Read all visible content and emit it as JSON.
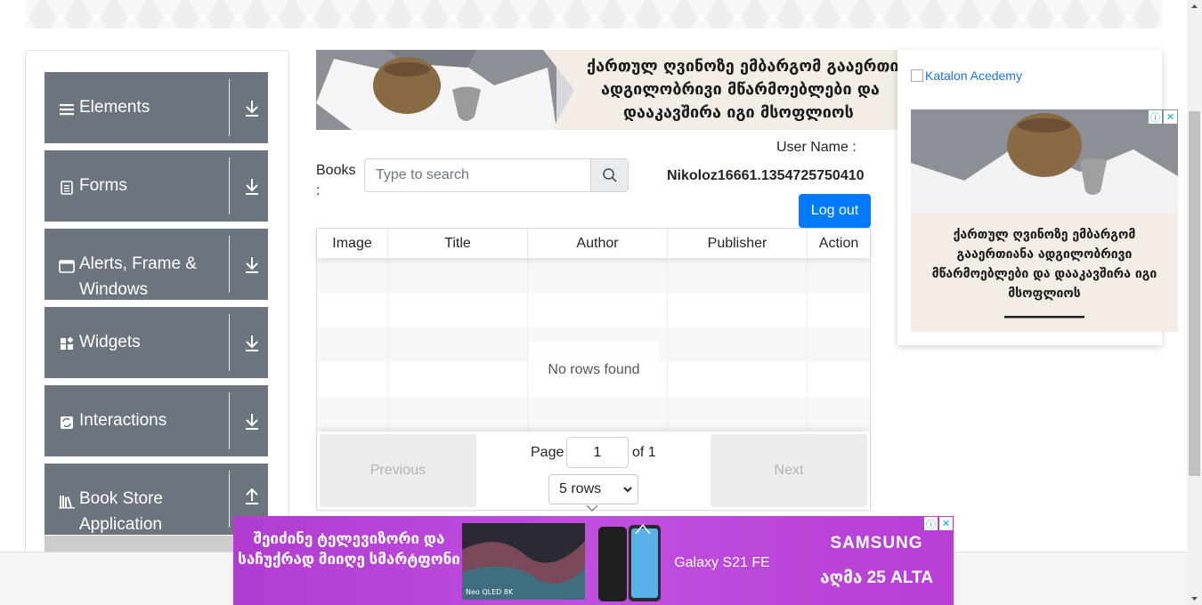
{
  "sidebar": {
    "groups": [
      {
        "label": "Elements",
        "icon": "hamburger-icon",
        "toggle": "download-arrow-icon"
      },
      {
        "label": "Forms",
        "icon": "document-icon",
        "toggle": "download-arrow-icon"
      },
      {
        "label": "Alerts, Frame & Windows",
        "icon": "window-icon",
        "toggle": "download-arrow-icon"
      },
      {
        "label": "Widgets",
        "icon": "widgets-icon",
        "toggle": "download-arrow-icon"
      },
      {
        "label": "Interactions",
        "icon": "interactions-icon",
        "toggle": "download-arrow-icon"
      },
      {
        "label": "Book Store Application",
        "icon": "books-icon",
        "toggle": "upload-arrow-icon"
      }
    ]
  },
  "banner": {
    "text_line1": "ქართულ ღვინოზე ემბარგომ გააერთიანა",
    "text_line2": "ადგილობრივი მწარმოებლები და",
    "text_line3": "დააკავშირა იგი მსოფლიოს"
  },
  "search": {
    "label": "Books :",
    "placeholder": "Type to search"
  },
  "user": {
    "label": "User Name :",
    "value": "Nikoloz16661.1354725750410",
    "logout": "Log out"
  },
  "table": {
    "columns": [
      "Image",
      "Title",
      "Author",
      "Publisher",
      "Action"
    ],
    "empty_message": "No rows found"
  },
  "pagination": {
    "previous": "Previous",
    "next": "Next",
    "page_label": "Page",
    "current_page": "1",
    "of_label": "of 1",
    "rows_option": "5 rows"
  },
  "right_ad": {
    "link_text": "Katalon Acedemy",
    "card_text": "ქართულ ღვინოზე ემბარგომ გააერთიანა ადგილობრივი მწარმოებლები და დააკავშირა იგი მსოფლიოს"
  },
  "bottom_ad": {
    "text": "შეიძინე ტელევიზორი და საჩუქრად მიიღე სმარტფონი",
    "tv_caption": "Neo QLED 8K",
    "phone_label": "Galaxy S21 FE",
    "brand": "SAMSUNG",
    "brand_sub": "აღმა 25 ALTA"
  },
  "colors": {
    "sidebar_bg": "#6c757d",
    "primary": "#007bff",
    "ad_purple": "#b03cd0"
  }
}
